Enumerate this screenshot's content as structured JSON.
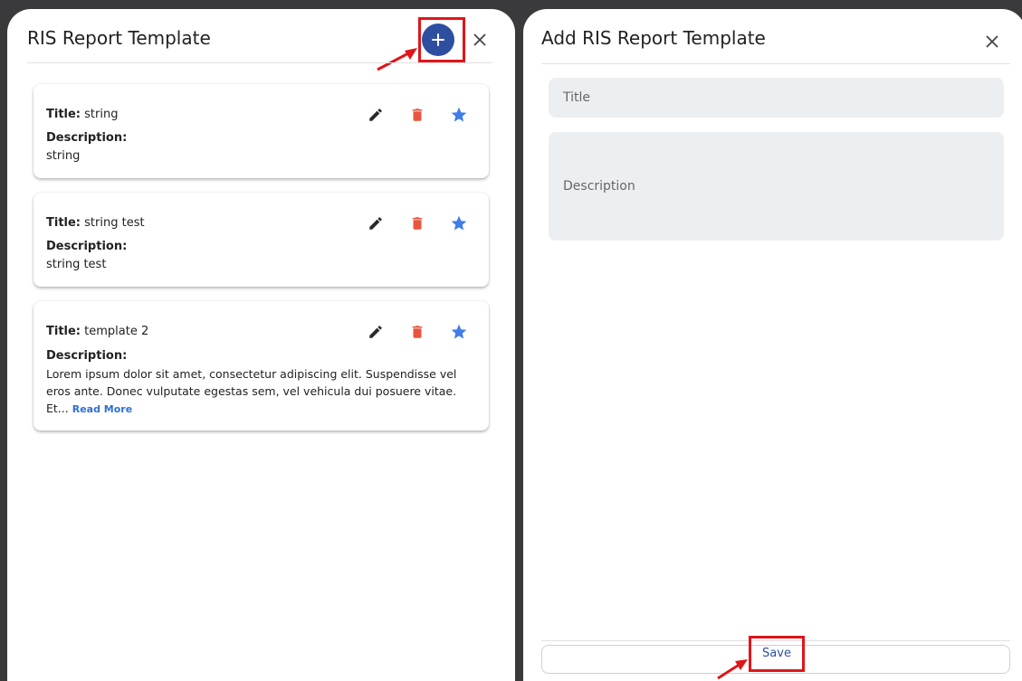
{
  "left_panel": {
    "title": "RIS Report Template",
    "cards": [
      {
        "title_label": "Title:",
        "title_value": "string",
        "desc_label": "Description:",
        "desc_value": "string"
      },
      {
        "title_label": "Title:",
        "title_value": "string test",
        "desc_label": "Description:",
        "desc_value": "string test"
      },
      {
        "title_label": "Title:",
        "title_value": "template 2",
        "desc_label": "Description:",
        "desc_value": "Lorem ipsum dolor sit amet, consectetur adipiscing elit. Suspendisse vel eros ante. Donec vulputate egestas sem, vel vehicula dui posuere vitae. Et...",
        "read_more": "Read More"
      }
    ],
    "icons": {
      "add": "plus-icon",
      "close": "close-icon",
      "edit": "pencil-icon",
      "delete": "trash-icon",
      "favorite": "star-icon"
    }
  },
  "right_panel": {
    "title": "Add RIS Report Template",
    "title_placeholder": "Title",
    "description_placeholder": "Description",
    "save_label": "Save"
  },
  "colors": {
    "add_button": "#2e4f9f",
    "delete_icon": "#e8553f",
    "star_icon": "#3f7ee8",
    "edit_icon": "#2a2a2a",
    "highlight": "#e0151a",
    "field_bg": "#eceff1"
  }
}
